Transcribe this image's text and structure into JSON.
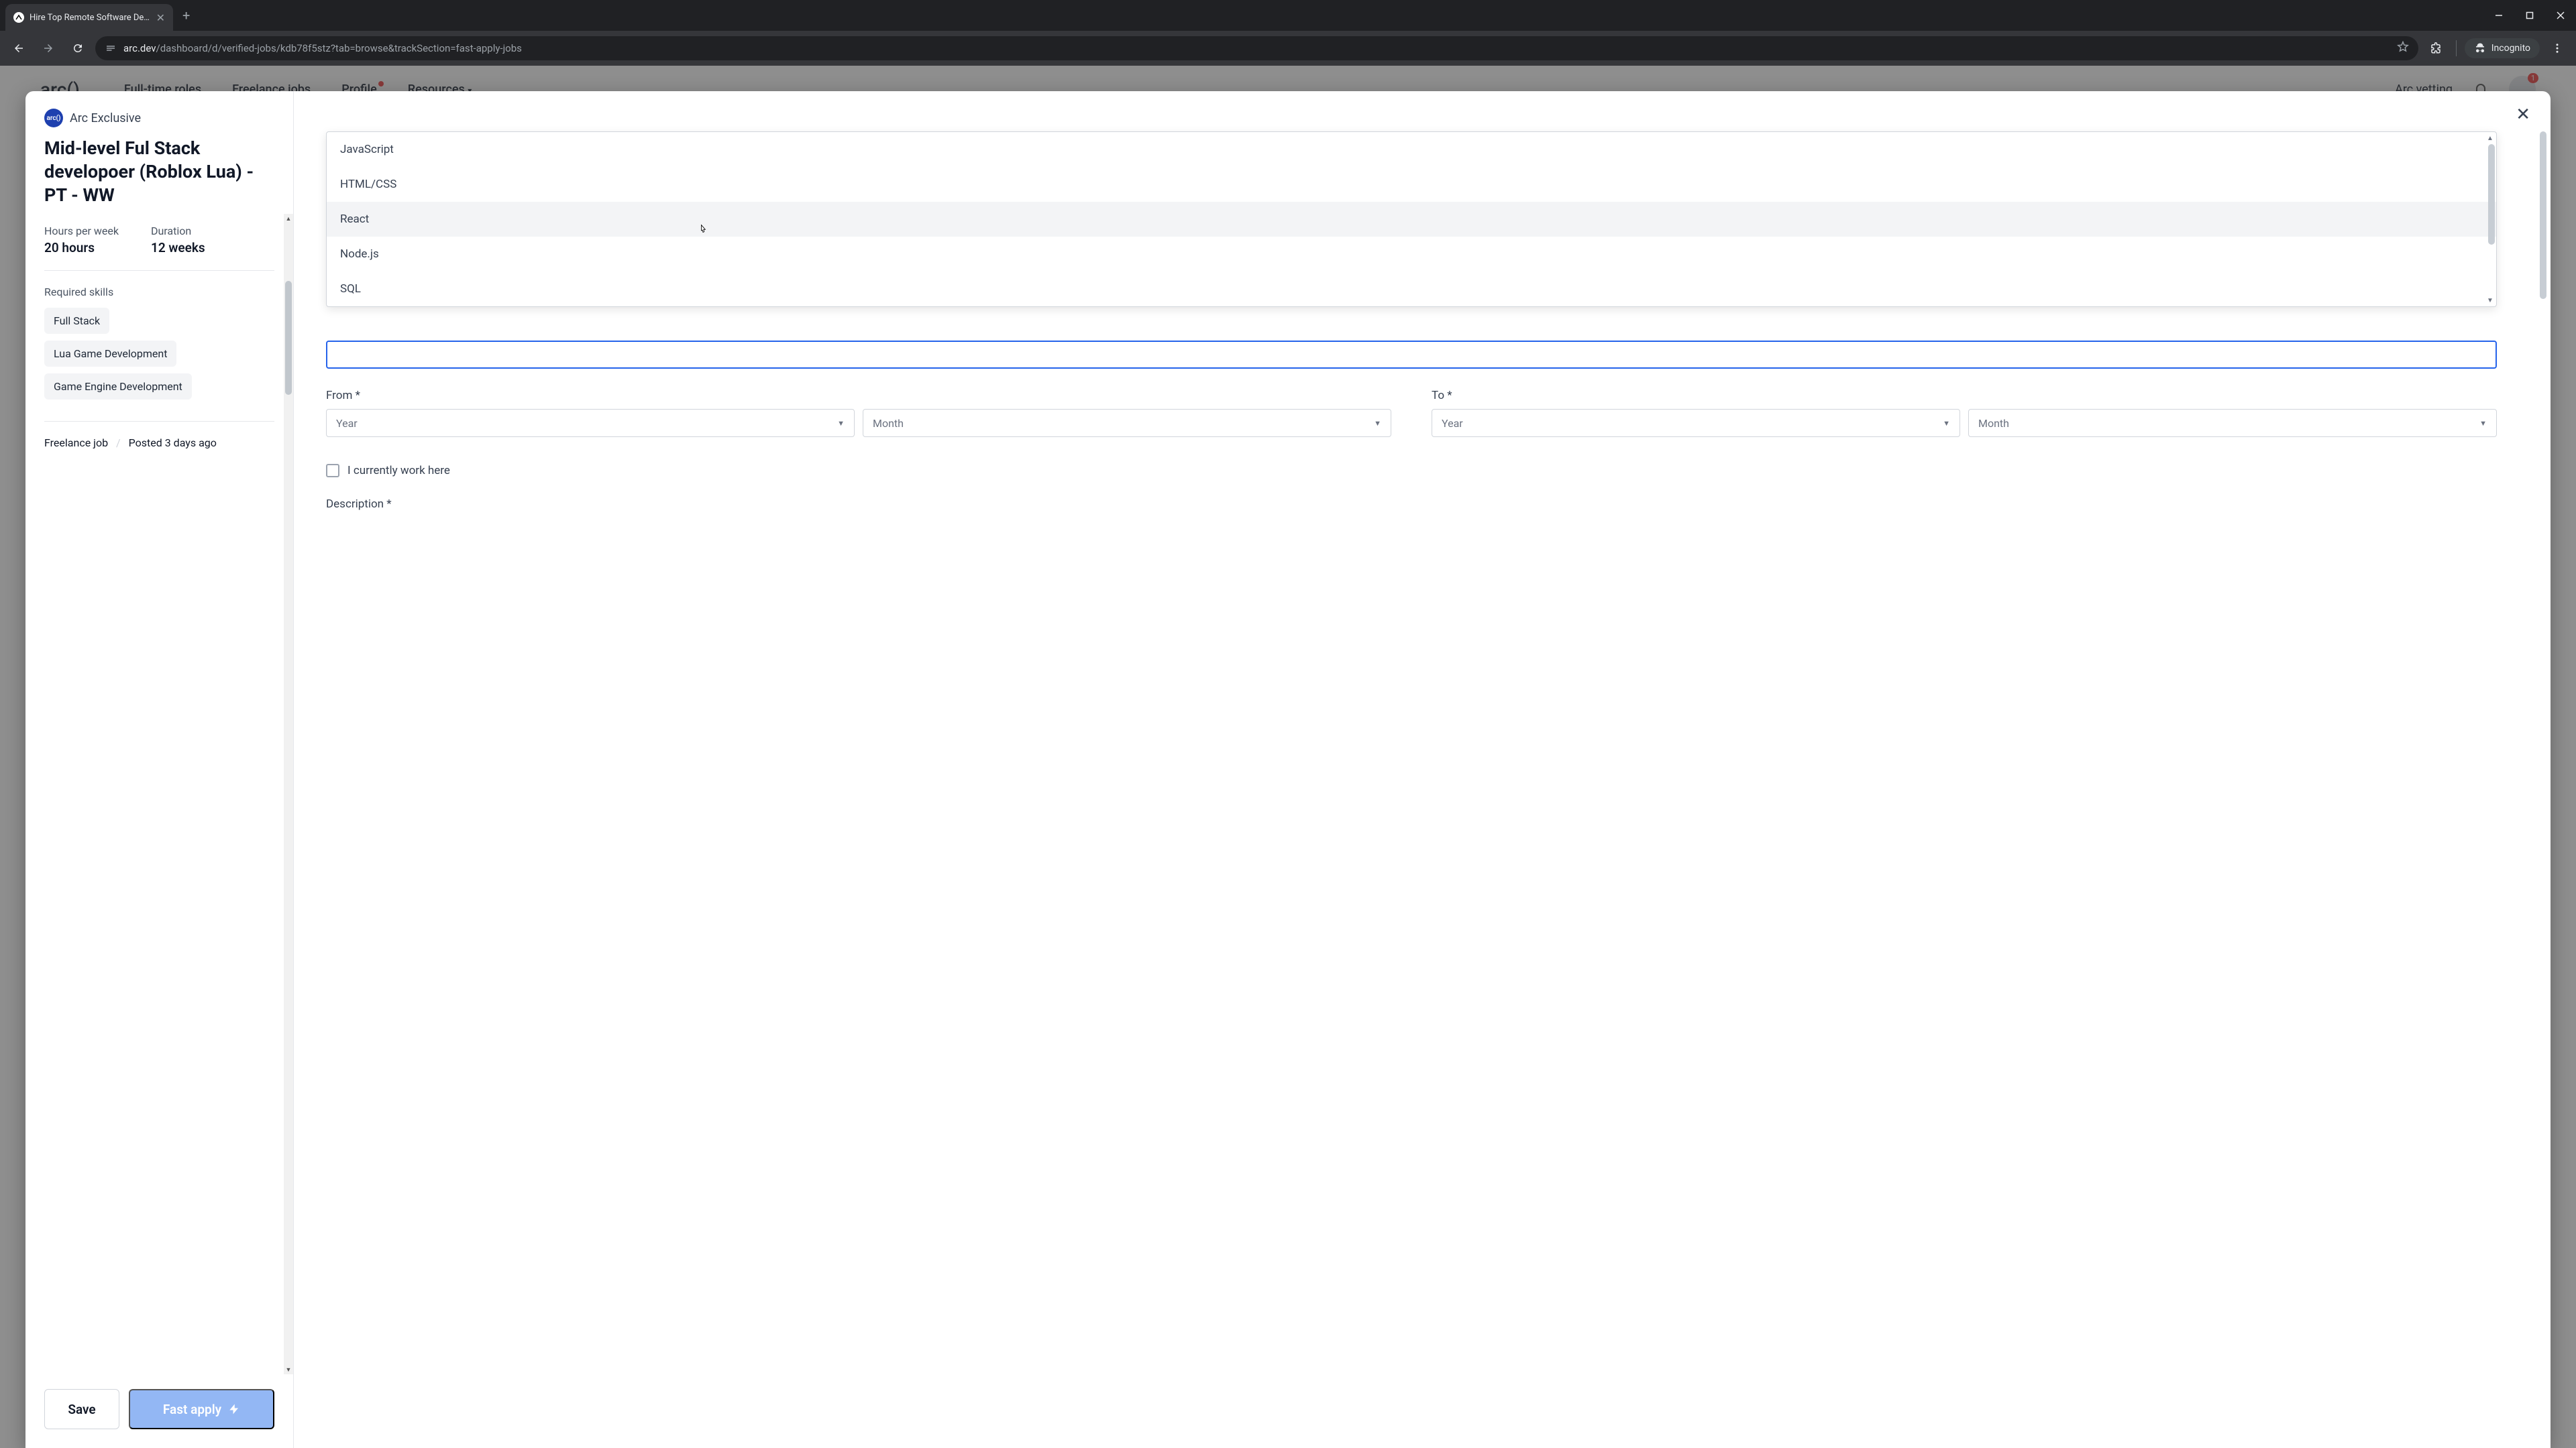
{
  "browser": {
    "tab_title": "Hire Top Remote Software Deve",
    "url_domain": "arc.dev",
    "url_path": "/dashboard/d/verified-jobs/kdb78f5stz?tab=browse&trackSection=fast-apply-jobs",
    "incognito_label": "Incognito"
  },
  "bg_nav": {
    "logo": "arc()",
    "items": [
      "Full-time roles",
      "Freelance jobs",
      "Profile",
      "Resources"
    ],
    "right_link": "Arc vetting",
    "notif_count": "1"
  },
  "sidebar": {
    "exclusive": "Arc Exclusive",
    "arc_badge": "arc()",
    "title": "Mid-level Ful Stack developoer (Roblox Lua) - PT - WW",
    "hours_label": "Hours per week",
    "hours_value": "20 hours",
    "duration_label": "Duration",
    "duration_value": "12 weeks",
    "skills_label": "Required skills",
    "skills": [
      "Full Stack",
      "Lua Game Development",
      "Game Engine Development"
    ],
    "job_type": "Freelance job",
    "posted": "Posted 3 days ago",
    "save_btn": "Save",
    "apply_btn": "Fast apply"
  },
  "form": {
    "dropdown_options": [
      "JavaScript",
      "HTML/CSS",
      "React",
      "Node.js",
      "SQL"
    ],
    "hovered_index": 2,
    "from_label": "From *",
    "to_label": "To *",
    "year_ph": "Year",
    "month_ph": "Month",
    "currently_work": "I currently work here",
    "description_label": "Description *"
  }
}
